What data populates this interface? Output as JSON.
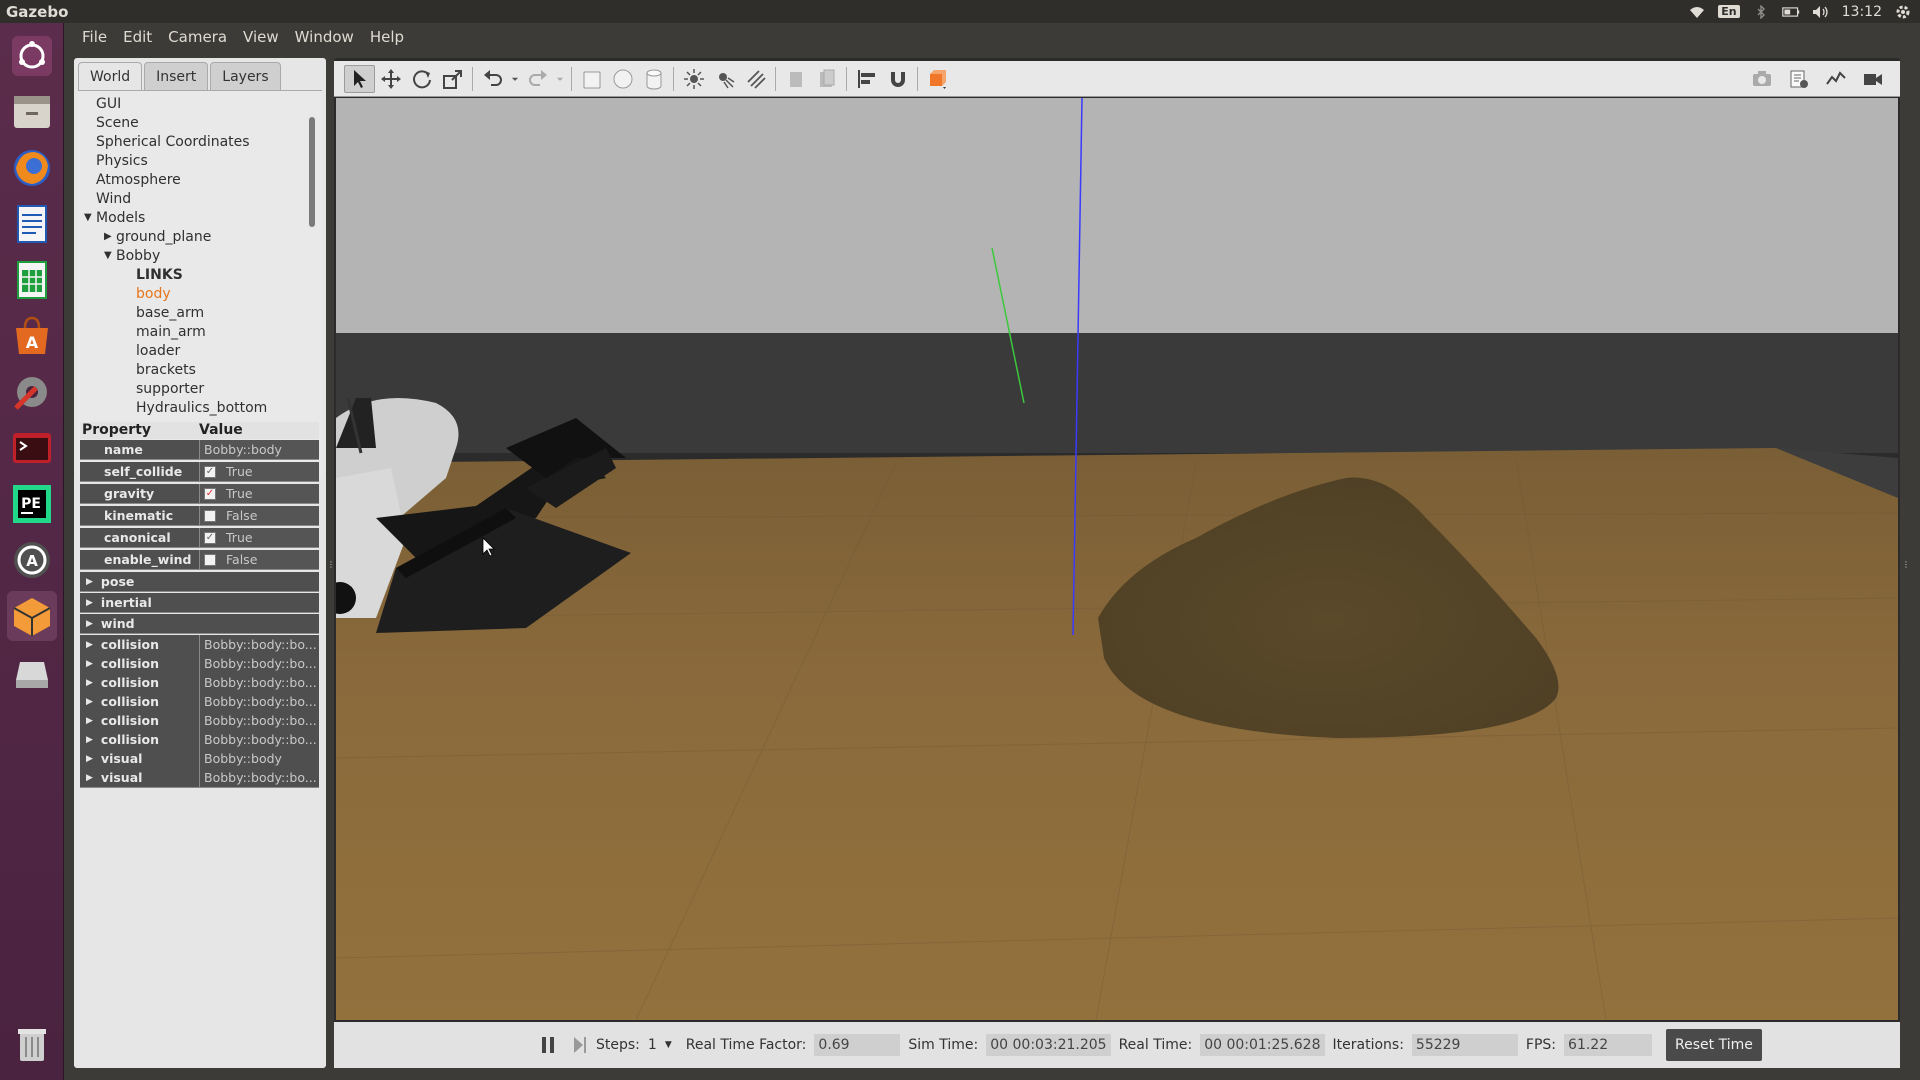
{
  "system": {
    "app_title": "Gazebo",
    "keyboard_layout": "En",
    "clock": "13:12"
  },
  "menu": [
    "File",
    "Edit",
    "Camera",
    "View",
    "Window",
    "Help"
  ],
  "left_panel": {
    "tabs": [
      "World",
      "Insert",
      "Layers"
    ],
    "active_tab": "World",
    "tree": [
      {
        "label": "GUI",
        "indent": 0,
        "arrow": ""
      },
      {
        "label": "Scene",
        "indent": 0,
        "arrow": ""
      },
      {
        "label": "Spherical Coordinates",
        "indent": 0,
        "arrow": ""
      },
      {
        "label": "Physics",
        "indent": 0,
        "arrow": ""
      },
      {
        "label": "Atmosphere",
        "indent": 0,
        "arrow": ""
      },
      {
        "label": "Wind",
        "indent": 0,
        "arrow": ""
      },
      {
        "label": "Models",
        "indent": 0,
        "arrow": "expanded"
      },
      {
        "label": "ground_plane",
        "indent": 1,
        "arrow": "collapsed"
      },
      {
        "label": "Bobby",
        "indent": 1,
        "arrow": "expanded"
      },
      {
        "label": "LINKS",
        "indent": 2,
        "arrow": "",
        "bold": true
      },
      {
        "label": "body",
        "indent": 2,
        "arrow": "",
        "selected": true
      },
      {
        "label": "base_arm",
        "indent": 2,
        "arrow": ""
      },
      {
        "label": "main_arm",
        "indent": 2,
        "arrow": ""
      },
      {
        "label": "loader",
        "indent": 2,
        "arrow": ""
      },
      {
        "label": "brackets",
        "indent": 2,
        "arrow": ""
      },
      {
        "label": "supporter",
        "indent": 2,
        "arrow": ""
      },
      {
        "label": "Hydraulics_bottom",
        "indent": 2,
        "arrow": ""
      }
    ],
    "property_header": {
      "property": "Property",
      "value": "Value"
    },
    "properties": [
      {
        "key": "name",
        "value": "Bobby::body",
        "checkbox": null
      },
      {
        "key": "self_collide",
        "value": "True",
        "checkbox": "checked-grey"
      },
      {
        "key": "gravity",
        "value": "True",
        "checkbox": "checked-red"
      },
      {
        "key": "kinematic",
        "value": "False",
        "checkbox": "unchecked"
      },
      {
        "key": "canonical",
        "value": "True",
        "checkbox": "checked-grey"
      },
      {
        "key": "enable_wind",
        "value": "False",
        "checkbox": "unchecked"
      }
    ],
    "groups": [
      {
        "key": "pose",
        "value": ""
      },
      {
        "key": "inertial",
        "value": ""
      },
      {
        "key": "wind",
        "value": ""
      },
      {
        "key": "collision",
        "value": "Bobby::body::bo..."
      },
      {
        "key": "collision",
        "value": "Bobby::body::bo..."
      },
      {
        "key": "collision",
        "value": "Bobby::body::bo..."
      },
      {
        "key": "collision",
        "value": "Bobby::body::bo..."
      },
      {
        "key": "collision",
        "value": "Bobby::body::bo..."
      },
      {
        "key": "collision",
        "value": "Bobby::body::bo..."
      },
      {
        "key": "visual",
        "value": "Bobby::body"
      },
      {
        "key": "visual",
        "value": "Bobby::body::bo..."
      }
    ]
  },
  "status": {
    "steps_label": "Steps:",
    "steps_value": "1",
    "rtf_label": "Real Time Factor:",
    "rtf_value": "0.69",
    "sim_time_label": "Sim Time:",
    "sim_time_value": "00 00:03:21.205",
    "real_time_label": "Real Time:",
    "real_time_value": "00 00:01:25.628",
    "iterations_label": "Iterations:",
    "iterations_value": "55229",
    "fps_label": "FPS:",
    "fps_value": "61.22",
    "reset_label": "Reset Time"
  },
  "colors": {
    "launcher": "#5b2c4b",
    "selected_tree": "#e8761c",
    "sky": "#b7b7b7",
    "ground": "#8a6a3a",
    "axis_z": "#3a3aff",
    "axis_y": "#3cc83c"
  }
}
